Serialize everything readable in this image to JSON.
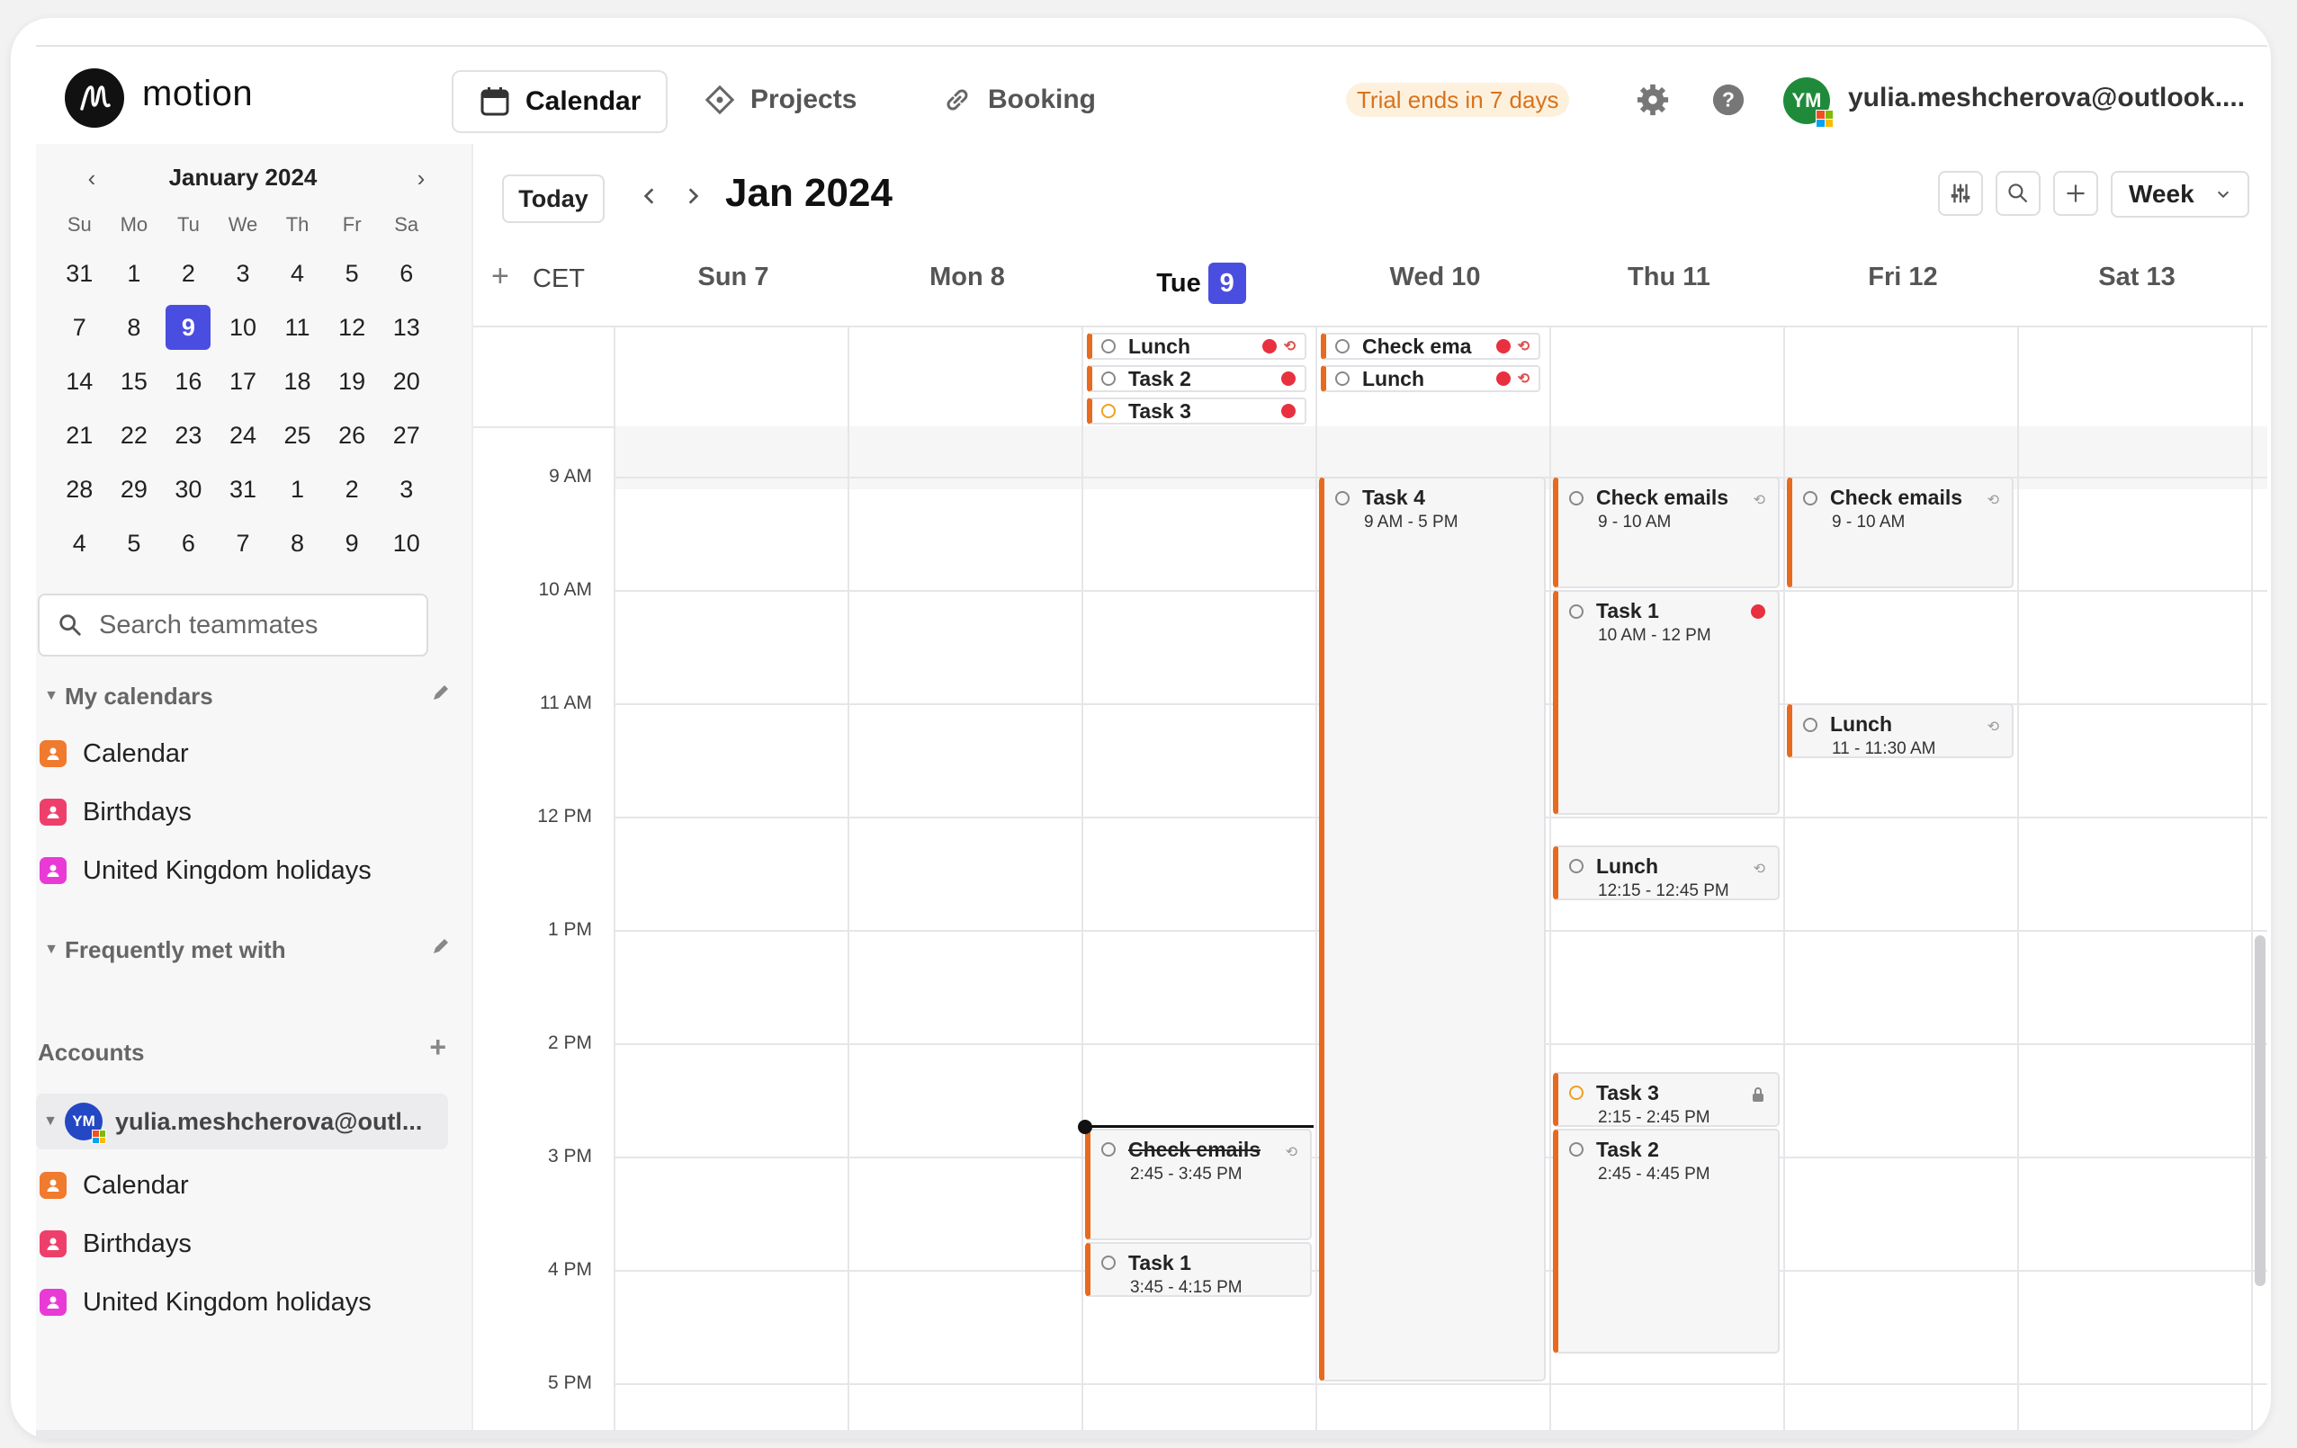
{
  "app": {
    "name": "motion",
    "nav": [
      {
        "label": "Calendar",
        "icon": "calendar-icon",
        "active": true
      },
      {
        "label": "Projects",
        "icon": "diamond-icon",
        "active": false
      },
      {
        "label": "Booking",
        "icon": "link-icon",
        "active": false
      }
    ],
    "trial_text": "Trial ends in 7 days",
    "user_initials": "YM",
    "user_email": "yulia.meshcherova@outlook...."
  },
  "mini_calendar": {
    "title": "January 2024",
    "weekdays": [
      "Su",
      "Mo",
      "Tu",
      "We",
      "Th",
      "Fr",
      "Sa"
    ],
    "weeks": [
      [
        "31",
        "1",
        "2",
        "3",
        "4",
        "5",
        "6"
      ],
      [
        "7",
        "8",
        "9",
        "10",
        "11",
        "12",
        "13"
      ],
      [
        "14",
        "15",
        "16",
        "17",
        "18",
        "19",
        "20"
      ],
      [
        "21",
        "22",
        "23",
        "24",
        "25",
        "26",
        "27"
      ],
      [
        "28",
        "29",
        "30",
        "31",
        "1",
        "2",
        "3"
      ],
      [
        "4",
        "5",
        "6",
        "7",
        "8",
        "9",
        "10"
      ]
    ],
    "selected": "9"
  },
  "sidebar": {
    "search_placeholder": "Search teammates",
    "my_calendars_label": "My calendars",
    "my_calendars": [
      {
        "label": "Calendar",
        "color": "#f07a2e"
      },
      {
        "label": "Birthdays",
        "color": "#ee3f6b"
      },
      {
        "label": "United Kingdom holidays",
        "color": "#e93ad6"
      }
    ],
    "frequently_met_label": "Frequently met with",
    "accounts_label": "Accounts",
    "account_email": "yulia.meshcherova@outl...",
    "account_initials": "YM",
    "account_calendars": [
      {
        "label": "Calendar",
        "color": "#f07a2e"
      },
      {
        "label": "Birthdays",
        "color": "#ee3f6b"
      },
      {
        "label": "United Kingdom holidays",
        "color": "#e93ad6"
      }
    ]
  },
  "calendar": {
    "today_label": "Today",
    "month_label": "Jan 2024",
    "view_label": "Week",
    "timezone": "CET",
    "days": [
      {
        "name": "Sun",
        "num": "7"
      },
      {
        "name": "Mon",
        "num": "8"
      },
      {
        "name": "Tue",
        "num": "9",
        "today": true
      },
      {
        "name": "Wed",
        "num": "10"
      },
      {
        "name": "Thu",
        "num": "11"
      },
      {
        "name": "Fri",
        "num": "12"
      },
      {
        "name": "Sat",
        "num": "13"
      }
    ],
    "hours": [
      "9 AM",
      "10 AM",
      "11 AM",
      "12 PM",
      "1 PM",
      "2 PM",
      "3 PM",
      "4 PM",
      "5 PM"
    ],
    "all_day": {
      "tue": [
        {
          "title": "Lunch",
          "ring": "grey"
        },
        {
          "title": "Task 2",
          "ring": "grey"
        },
        {
          "title": "Task 3",
          "ring": "orange"
        }
      ],
      "wed": [
        {
          "title": "Check ema",
          "ring": "grey"
        },
        {
          "title": "Lunch",
          "ring": "grey"
        }
      ]
    },
    "events": {
      "wed_task4": {
        "title": "Task 4",
        "time": "9 AM - 5 PM"
      },
      "thu_check": {
        "title": "Check emails",
        "time": "9 - 10 AM"
      },
      "thu_task1": {
        "title": "Task 1",
        "time": "10 AM - 12 PM"
      },
      "thu_lunch": {
        "title": "Lunch",
        "time": "12:15 - 12:45 PM"
      },
      "thu_task3": {
        "title": "Task 3",
        "time": "2:15 - 2:45 PM"
      },
      "thu_task2": {
        "title": "Task 2",
        "time": "2:45 - 4:45 PM"
      },
      "fri_check": {
        "title": "Check emails",
        "time": "9 - 10 AM"
      },
      "fri_lunch": {
        "title": "Lunch",
        "time": "11 - 11:30 AM"
      },
      "tue_check": {
        "title": "Check emails",
        "time": "2:45 - 3:45 PM"
      },
      "tue_task1": {
        "title": "Task 1",
        "time": "3:45 - 4:15 PM"
      }
    }
  }
}
